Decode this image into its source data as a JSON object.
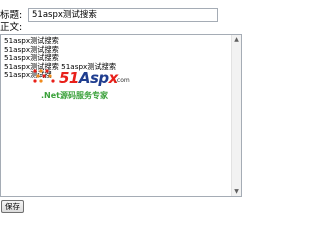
{
  "form": {
    "title_label": "标题:",
    "title_value": "51aspx测试搜索",
    "body_label": "正文:",
    "body_lines": [
      "51aspx测试搜索",
      "51aspx测试搜索",
      "51aspx测试搜索",
      "51aspx测试搜索 51aspx测试搜索",
      "51aspx测试搜"
    ],
    "save_label": "保存"
  },
  "watermark": {
    "logo_num": "51",
    "logo_asp": "Asp",
    "logo_x": "x",
    "logo_com": ".com",
    "tagline": ".Net源码服务专家"
  },
  "colors": {
    "logo_red": "#e8201a",
    "logo_blue": "#1f3d8f",
    "tagline_green": "#3aa13a"
  }
}
